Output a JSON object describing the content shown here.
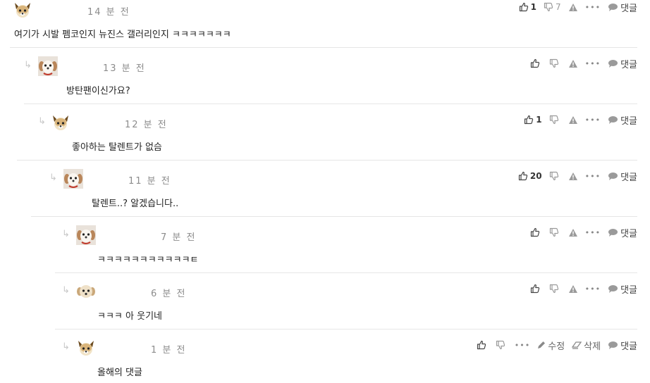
{
  "comments": [
    {
      "time": "14 분 전",
      "body": "여기가 시발 펨코인지 뉴진스 갤러리인지 ㅋㅋㅋㅋㅋㅋㅋ",
      "likes": "1",
      "dislikes": "7",
      "avatar": "dog-tan",
      "reply_label": "댓글"
    },
    {
      "time": "13 분 전",
      "body": "방탄팬이신가요?",
      "likes": "",
      "dislikes": "",
      "avatar": "dog-white",
      "reply_label": "댓글"
    },
    {
      "time": "12 분 전",
      "body": "좋아하는 탈렌트가 없슴",
      "likes": "1",
      "dislikes": "",
      "avatar": "dog-tan",
      "reply_label": "댓글"
    },
    {
      "time": "11 분 전",
      "body": "탈렌트..? 알겠습니다..",
      "likes": "20",
      "dislikes": "",
      "avatar": "dog-white",
      "reply_label": "댓글"
    },
    {
      "time": "7 분 전",
      "body": "ㅋㅋㅋㅋㅋㅋㅋㅋㅋㅋㅋㅌ",
      "likes": "",
      "dislikes": "",
      "avatar": "dog-white",
      "reply_label": "댓글"
    },
    {
      "time": "6 분 전",
      "body": "ㅋㅋㅋ 아 웃기네",
      "likes": "",
      "dislikes": "",
      "avatar": "dog-cream",
      "reply_label": "댓글"
    },
    {
      "time": "1 분 전",
      "body": "올해의 댓글",
      "likes": "",
      "dislikes": "",
      "avatar": "dog-tan",
      "reply_label": "댓글",
      "edit_label": "수정",
      "delete_label": "삭제"
    }
  ],
  "icons": {
    "like": "thumbs-up-icon",
    "dislike": "thumbs-down-icon",
    "report": "warning-icon",
    "more": "more-icon",
    "reply": "speech-bubble-icon",
    "edit": "pencil-icon",
    "delete": "eraser-icon",
    "reply_arrow": "reply-arrow-icon"
  }
}
